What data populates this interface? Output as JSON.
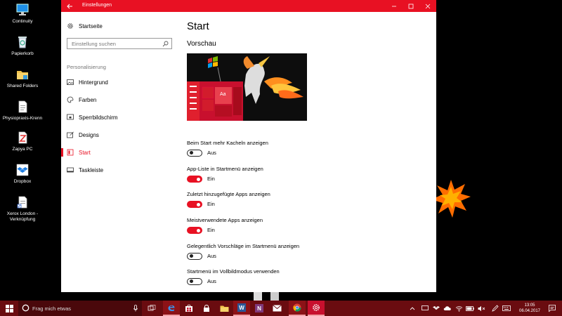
{
  "desktop": {
    "icons": [
      {
        "label": "Continuity",
        "icon": "monitor-icon"
      },
      {
        "label": "Papierkorb",
        "icon": "recycle-bin-icon"
      },
      {
        "label": "Shared Folders",
        "icon": "folder-icon"
      },
      {
        "label": "Physiopraxis-Krenn",
        "icon": "document-icon"
      },
      {
        "label": "Zapya PC",
        "icon": "zapya-icon"
      },
      {
        "label": "Dropbox",
        "icon": "dropbox-icon"
      },
      {
        "label": "Xerox London - Verknüpfung",
        "icon": "document-icon"
      }
    ]
  },
  "window": {
    "title": "Einstellungen",
    "accent": "#e81123"
  },
  "nav": {
    "home_label": "Startseite",
    "search_placeholder": "Einstellung suchen",
    "section_label": "Personalisierung",
    "items": [
      {
        "label": "Hintergrund",
        "icon": "image-icon"
      },
      {
        "label": "Farben",
        "icon": "palette-icon"
      },
      {
        "label": "Sperrbildschirm",
        "icon": "lock-screen-icon"
      },
      {
        "label": "Designs",
        "icon": "brush-icon"
      },
      {
        "label": "Start",
        "icon": "start-menu-icon",
        "active": true
      },
      {
        "label": "Taskleiste",
        "icon": "taskbar-icon"
      }
    ]
  },
  "content": {
    "title": "Start",
    "preview_title": "Vorschau",
    "preview_tile_label": "Aa",
    "settings": [
      {
        "label": "Beim Start mehr Kacheln anzeigen",
        "state": "Aus",
        "on": false
      },
      {
        "label": "App-Liste in Startmenü anzeigen",
        "state": "Ein",
        "on": true
      },
      {
        "label": "Zuletzt hinzugefügte Apps anzeigen",
        "state": "Ein",
        "on": true
      },
      {
        "label": "Meistverwendete Apps anzeigen",
        "state": "Ein",
        "on": true
      },
      {
        "label": "Gelegentlich Vorschläge im Startmenü anzeigen",
        "state": "Aus",
        "on": false
      },
      {
        "label": "Startmenü im Vollbildmodus verwenden",
        "state": "Aus",
        "on": false
      }
    ]
  },
  "taskbar": {
    "search_placeholder": "Frag mich etwas",
    "apps": [
      "task-view-icon",
      "edge-icon",
      "store-icon",
      "lock-icon",
      "file-explorer-icon",
      "word-icon",
      "onenote-icon",
      "mail-icon",
      "chrome-icon",
      "settings-icon"
    ],
    "clock_time": "13:05",
    "clock_date": "06.04.2017"
  }
}
